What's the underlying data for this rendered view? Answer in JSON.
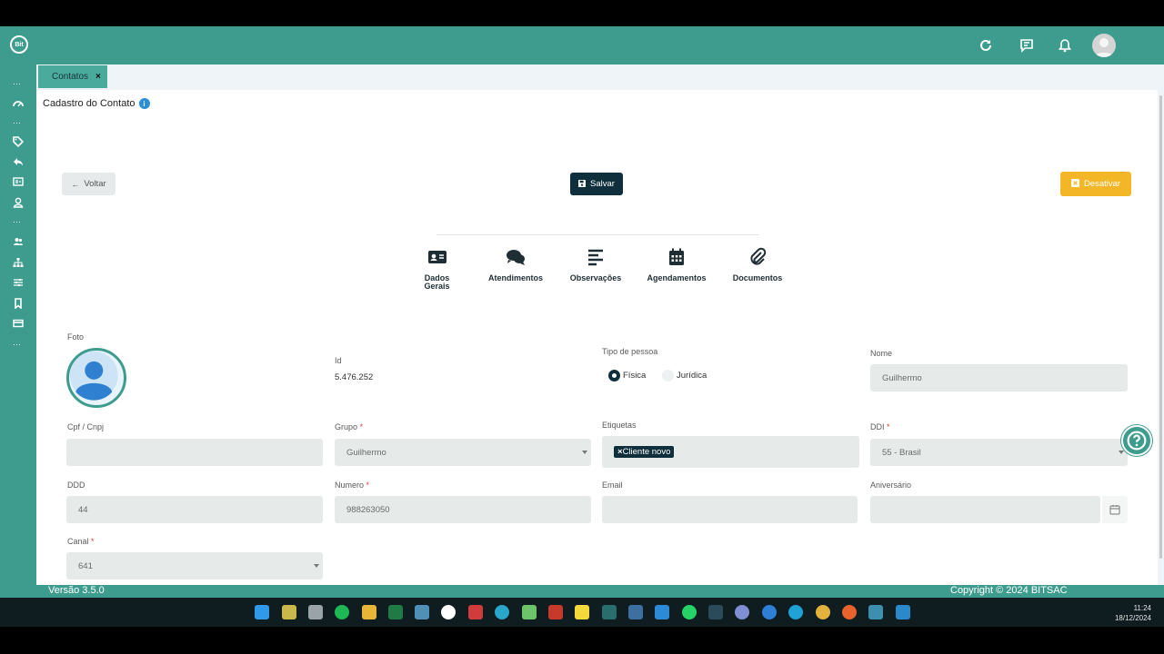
{
  "header": {
    "logo_text": "Bit",
    "icons": [
      "refresh-icon",
      "chat-icon",
      "bell-icon",
      "user-avatar"
    ]
  },
  "sidebar": {
    "icons": [
      "dots",
      "speedometer-icon",
      "dots",
      "tag-icon",
      "reply-icon",
      "id-card-icon",
      "user-icon",
      "dots",
      "users-icon",
      "sitemap-icon",
      "sliders-icon",
      "bookmark-icon",
      "credit-card-icon",
      "dots"
    ]
  },
  "tabs": [
    {
      "label": "Contatos",
      "close": "×"
    }
  ],
  "page": {
    "title": "Cadastro do Contato",
    "info_icon": "i"
  },
  "buttons": {
    "back": "Voltar",
    "save": "Salvar",
    "deactivate": "Desativar"
  },
  "steps": [
    {
      "label_1": "Dados",
      "label_2": "Gerais",
      "icon": "id-card-icon"
    },
    {
      "label_1": "Atendimentos",
      "label_2": "",
      "icon": "comments-icon"
    },
    {
      "label_1": "Observações",
      "label_2": "",
      "icon": "align-left-icon"
    },
    {
      "label_1": "Agendamentos",
      "label_2": "",
      "icon": "calendar-icon"
    },
    {
      "label_1": "Documentos",
      "label_2": "",
      "icon": "paperclip-icon"
    }
  ],
  "form": {
    "foto_label": "Foto",
    "id_label": "Id",
    "id_value": "5.476.252",
    "tipo_label": "Tipo de pessoa",
    "tipo_fisica": "Física",
    "tipo_juridica": "Jurídica",
    "tipo_selected": "Física",
    "nome_label": "Nome",
    "nome_value": "Guilhermo",
    "cpf_label": "Cpf / Cnpj",
    "cpf_value": "",
    "grupo_label": "Grupo",
    "grupo_value": "Guilhermo",
    "etiquetas_label": "Etiquetas",
    "etiqueta_chip": "Cliente novo",
    "etiqueta_chip_remove": "×",
    "ddi_label": "DDI",
    "ddi_value": "55 - Brasil",
    "ddd_label": "DDD",
    "ddd_value": "44",
    "numero_label": "Numero",
    "numero_value": "988263050",
    "email_label": "Email",
    "email_value": "",
    "aniversario_label": "Aniversário",
    "aniversario_value": "",
    "canal_label": "Canal",
    "canal_value": "641",
    "required_mark": "*"
  },
  "footer": {
    "version": "Versão 3.5.0",
    "copyright": "Copyright © 2024 BITSAC"
  },
  "taskbar": {
    "time": "11:24",
    "date": "18/12/2024"
  },
  "colors": {
    "brand": "#3e9c8e",
    "dark": "#0f2f3c",
    "warning": "#f2b627",
    "field": "#e6ebea"
  }
}
